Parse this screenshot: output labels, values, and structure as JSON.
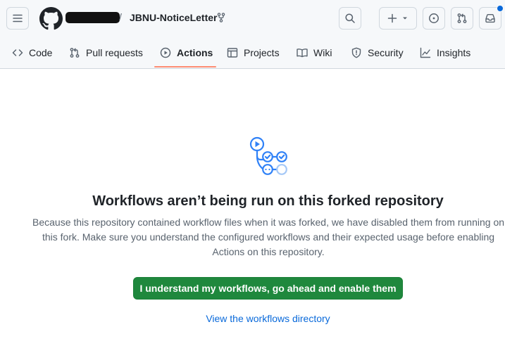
{
  "header": {
    "repo_separator": "/",
    "repo_name": "JBNU-NoticeLetter"
  },
  "nav": {
    "tabs": [
      {
        "label": "Code",
        "icon": "code-icon"
      },
      {
        "label": "Pull requests",
        "icon": "pull-request-icon"
      },
      {
        "label": "Actions",
        "icon": "play-icon",
        "active": true
      },
      {
        "label": "Projects",
        "icon": "table-icon"
      },
      {
        "label": "Wiki",
        "icon": "book-icon"
      },
      {
        "label": "Security",
        "icon": "shield-icon"
      },
      {
        "label": "Insights",
        "icon": "graph-icon"
      }
    ]
  },
  "main": {
    "title": "Workflows aren’t being run on this forked repository",
    "description": "Because this repository contained workflow files when it was forked, we have disabled them from running on this fork. Make sure you understand the configured workflows and their expected usage before enabling Actions on this repository.",
    "enable_button": "I understand my workflows, go ahead and enable them",
    "directory_link": "View the workflows directory"
  },
  "colors": {
    "accent": "#0969da",
    "enable_button": "#1f883d",
    "active_tab_underline": "#fd8c73",
    "workflow_icon": "#2f81f7"
  }
}
